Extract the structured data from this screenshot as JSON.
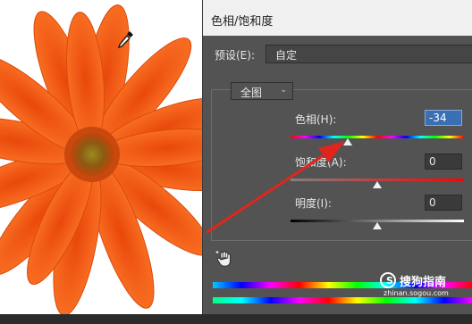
{
  "dialog": {
    "title": "色相/饱和度",
    "preset_label": "预设(E):",
    "preset_value": "自定",
    "channel_value": "全图",
    "hue": {
      "label": "色相(H):",
      "value": "-34"
    },
    "saturation": {
      "label": "饱和度(A):",
      "value": "0"
    },
    "lightness": {
      "label": "明度(I):",
      "value": "0"
    }
  },
  "watermark": {
    "brand": "搜狗指南",
    "url": "zhinan.sogou.com"
  },
  "colors": {
    "annotation_arrow": "#e0261c",
    "flower": "#f5611a",
    "hue_field_active": "#3b6fb4"
  },
  "icons": [
    "eyedropper-icon",
    "chevron-down-icon",
    "targeted-adjustment-hand-icon",
    "sogou-logo-icon"
  ]
}
